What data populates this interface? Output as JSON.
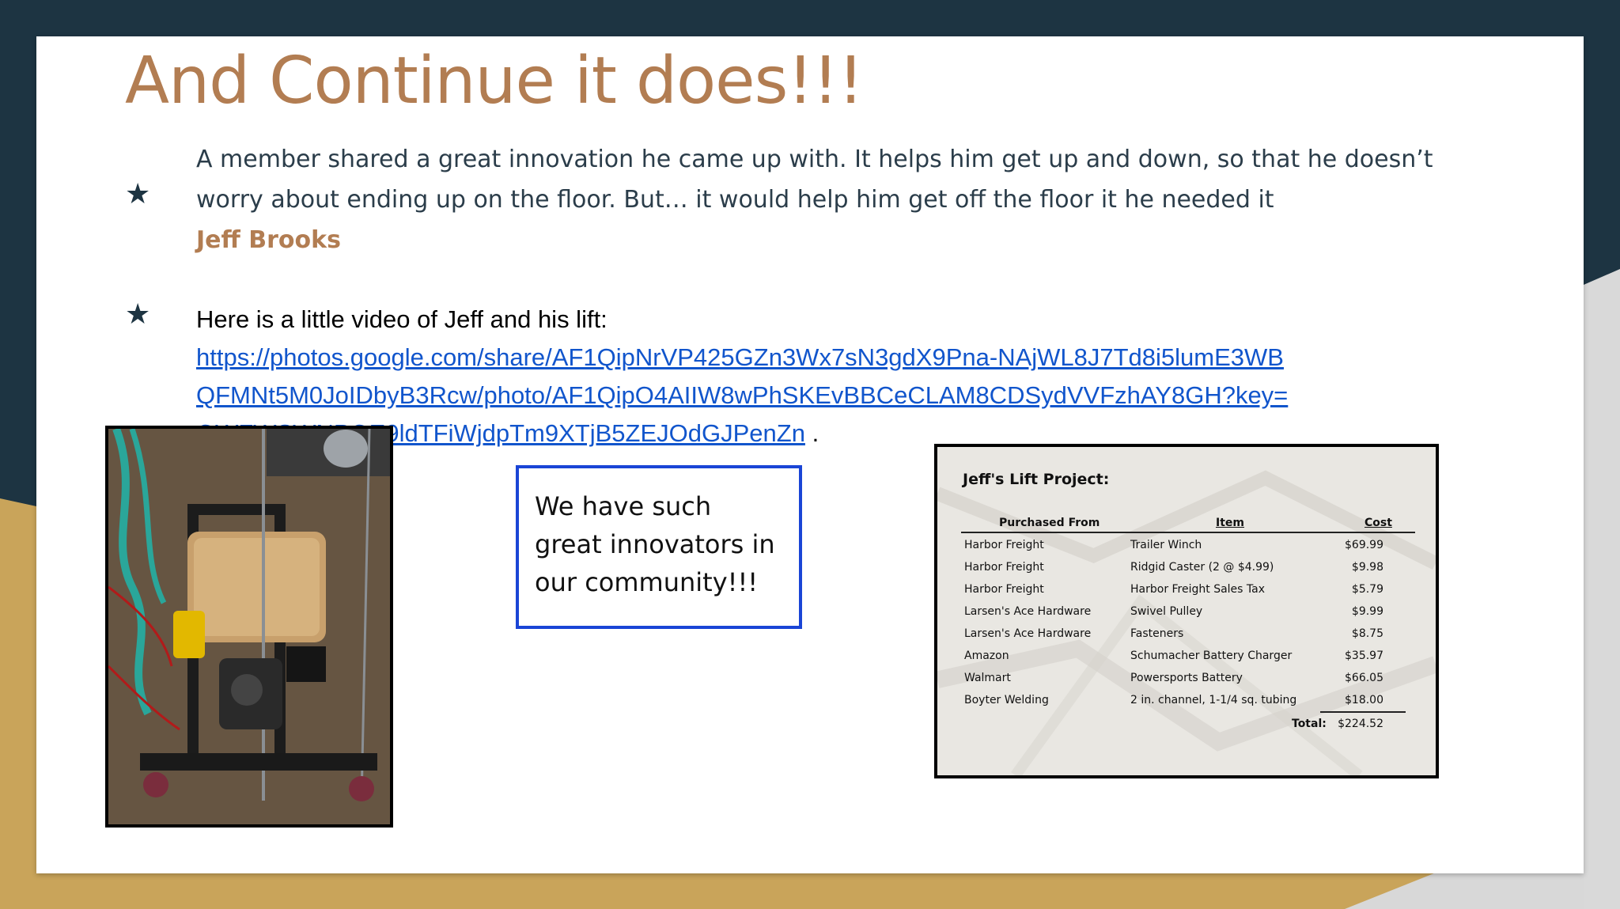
{
  "slide": {
    "title": "And Continue it does!!!",
    "bullet_glyph": "★",
    "bullet1": {
      "text": "A member shared a great innovation he came up with. It helps him get up and down, so that he doesn’t worry about ending up on the floor. But… it would help him get off the floor it he needed it",
      "author": "Jeff Brooks"
    },
    "bullet2": {
      "intro": "Here is a little video of Jeff and his lift:",
      "link_line1": "https://photos.google.com/share/AF1QipNrVP425GZn3Wx7sN3gdX9Pna-NAjWL8J7Td8i5lumE3WB",
      "link_line2": "QFMNt5M0JoIDbyB3Rcw/photo/AF1QipO4AIIW8wPhSKEvBBCeCLAM8CDSydVVFzhAY8GH?key=",
      "link_line3": "QWFWSWNPOE9ldTFiWjdpTm9XTjB5ZEJOdGJPenZn",
      "trailing": "."
    },
    "callout": "We have such great innovators in our community!!!",
    "receipt": {
      "title": "Jeff's Lift Project:",
      "headers": {
        "from": "Purchased From",
        "item": "Item",
        "cost": "Cost"
      },
      "rows": [
        {
          "from": "Harbor Freight",
          "item": "Trailer Winch",
          "cost": "$69.99"
        },
        {
          "from": "Harbor Freight",
          "item": "Ridgid Caster (2 @ $4.99)",
          "cost": "$9.98"
        },
        {
          "from": "Harbor Freight",
          "item": "Harbor Freight Sales Tax",
          "cost": "$5.79"
        },
        {
          "from": "Larsen's Ace Hardware",
          "item": "Swivel Pulley",
          "cost": "$9.99"
        },
        {
          "from": "Larsen's Ace Hardware",
          "item": "Fasteners",
          "cost": "$8.75"
        },
        {
          "from": "Amazon",
          "item": "Schumacher Battery Charger",
          "cost": "$35.97"
        },
        {
          "from": "Walmart",
          "item": "Powersports Battery",
          "cost": "$66.05"
        },
        {
          "from": "Boyter Welding",
          "item": "2 in. channel, 1-1/4 sq. tubing",
          "cost": "$18.00"
        }
      ],
      "total_label": "Total:",
      "total_value": "$224.52"
    },
    "colors": {
      "navy": "#1d3442",
      "gold": "#c9a45a",
      "title_brown": "#b27d52",
      "link_blue": "#1155cc",
      "callout_border": "#1a45d6"
    }
  }
}
